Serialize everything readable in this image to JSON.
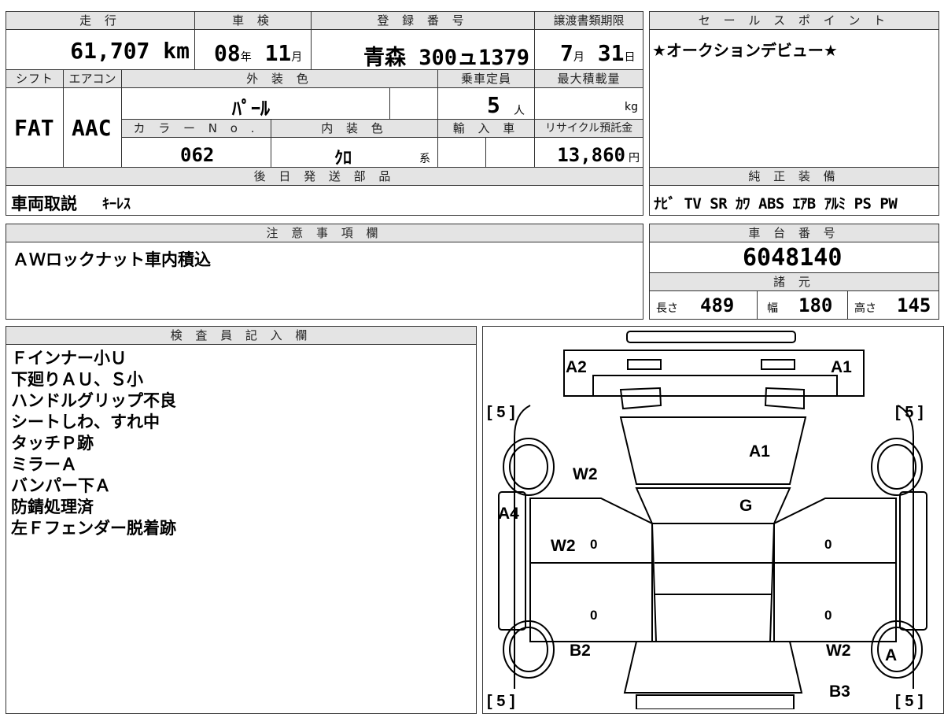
{
  "top_table": {
    "headers": {
      "mileage": "走 行",
      "inspection": "車 検",
      "registration": "登 録 番 号",
      "transfer_deadline": "譲渡書類期限",
      "sales_point": "セ ー ル ス ポ イ ン ト",
      "shift": "シフト",
      "aircon": "エアコン",
      "exterior_color": "外 装 色",
      "capacity": "乗車定員",
      "max_load": "最大積載量",
      "color_no": "カ ラ ー N o .",
      "interior_color": "内 装 色",
      "import": "輸 入 車",
      "recycle": "リサイクル預託金",
      "later_parts": "後 日 発 送 部 品",
      "equipment": "純 正 装 備"
    },
    "mileage_value": "61,707",
    "mileage_unit": "km",
    "inspection_year": "08",
    "inspection_year_unit": "年",
    "inspection_month": "11",
    "inspection_month_unit": "月",
    "registration_value": "青森 300ュ1379",
    "transfer_month": "7",
    "transfer_month_unit": "月",
    "transfer_day": "31",
    "transfer_day_unit": "日",
    "sales_point_value": "★オークションデビュー★",
    "shift_value": "FAT",
    "aircon_value": "AAC",
    "exterior_color_value": "ﾊﾟｰﾙ",
    "capacity_value": "5",
    "capacity_unit": "人",
    "max_load_unit": "kg",
    "color_no_value": "062",
    "interior_color_value": "ｸﾛ",
    "interior_color_suffix": "系",
    "recycle_value": "13,860",
    "recycle_unit": "円",
    "later_parts_value": "車両取説",
    "later_parts_extra": "ｷｰﾚｽ",
    "equipment_value": "ﾅﾋﾞ TV SR ｶﾜ ABS ｴｱB ｱﾙﾐ PS PW"
  },
  "notes": {
    "header": "注 意 事 項 欄",
    "value": "ＡＷロックナット車内積込"
  },
  "chassis": {
    "header": "車 台 番 号",
    "value": "6048140",
    "spec_header": "諸 元",
    "length_label": "長さ",
    "length_value": "489",
    "width_label": "幅",
    "width_value": "180",
    "height_label": "高さ",
    "height_value": "145"
  },
  "inspector": {
    "header": "検 査 員 記 入 欄",
    "lines": [
      "Ｆインナー小Ｕ",
      "下廻りＡＵ、Ｓ小",
      "ハンドルグリップ不良",
      "シートしわ、すれ中",
      "タッチＰ跡",
      "ミラーＡ",
      "バンパー下Ａ",
      "防錆処理済",
      "左Ｆフェンダー脱着跡"
    ]
  },
  "diagram": {
    "tire_labels": [
      "[ 5 ]",
      "[ 5 ]",
      "[ 5 ]",
      "[ 5 ]"
    ],
    "marks": {
      "a2": "A2",
      "a1_front": "A1",
      "a1_hood": "A1",
      "w2_left_fender": "W2",
      "g_windshield": "G",
      "a4_left": "A4",
      "w2_left_door": "W2",
      "b2_rear_left": "B2",
      "w2_rear_right": "W2",
      "a_rear_right": "A",
      "b3_rear_right": "B3"
    },
    "door_zeros": [
      "0",
      "0",
      "0",
      "0"
    ]
  }
}
